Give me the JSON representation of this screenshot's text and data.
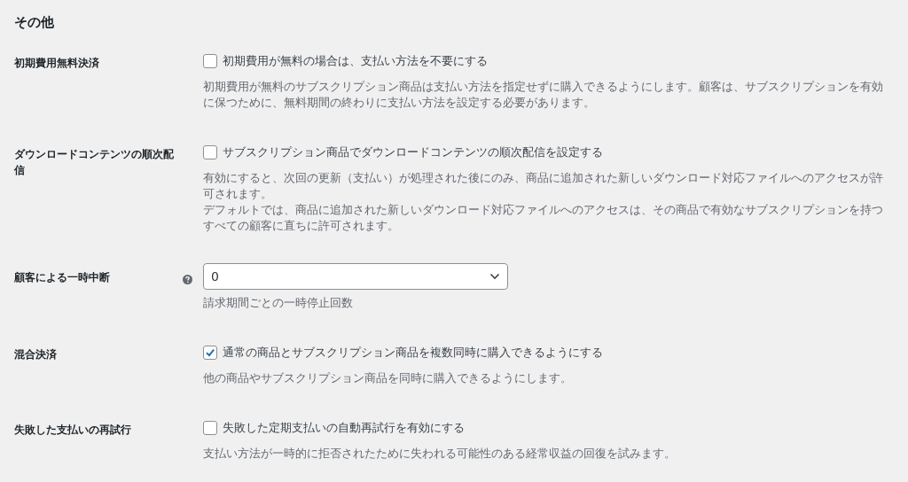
{
  "section_title": "その他",
  "settings": [
    {
      "kind": "checkbox",
      "label": "初期費用無料決済",
      "help": false,
      "checked": false,
      "option": "初期費用が無料の場合は、支払い方法を不要にする",
      "description": [
        "初期費用が無料のサブスクリプション商品は支払い方法を指定せずに購入できるようにします。顧客は、サブスクリプションを有効に保つために、無料期間の終わりに支払い方法を設定する必要があります。"
      ]
    },
    {
      "kind": "checkbox",
      "label": "ダウンロードコンテンツの順次配信",
      "help": false,
      "checked": false,
      "option": "サブスクリプション商品でダウンロードコンテンツの順次配信を設定する",
      "description": [
        "有効にすると、次回の更新（支払い）が処理された後にのみ、商品に追加された新しいダウンロード対応ファイルへのアクセスが許可されます。",
        "デフォルトでは、商品に追加された新しいダウンロード対応ファイルへのアクセスは、その商品で有効なサブスクリプションを持つすべての顧客に直ちに許可されます。"
      ]
    },
    {
      "kind": "select",
      "label": "顧客による一時中断",
      "help": true,
      "value": "0",
      "description": [
        "請求期間ごとの一時停止回数"
      ]
    },
    {
      "kind": "checkbox",
      "label": "混合決済",
      "help": false,
      "checked": true,
      "option": "通常の商品とサブスクリプション商品を複数同時に購入できるようにする",
      "description": [
        "他の商品やサブスクリプション商品を同時に購入できるようにします。"
      ]
    },
    {
      "kind": "checkbox",
      "label": "失敗した支払いの再試行",
      "help": false,
      "checked": false,
      "option": "失敗した定期支払いの自動再試行を有効にする",
      "description": [
        "支払い方法が一時的に拒否されたために失われる可能性のある経常収益の回復を試みます。"
      ]
    }
  ]
}
